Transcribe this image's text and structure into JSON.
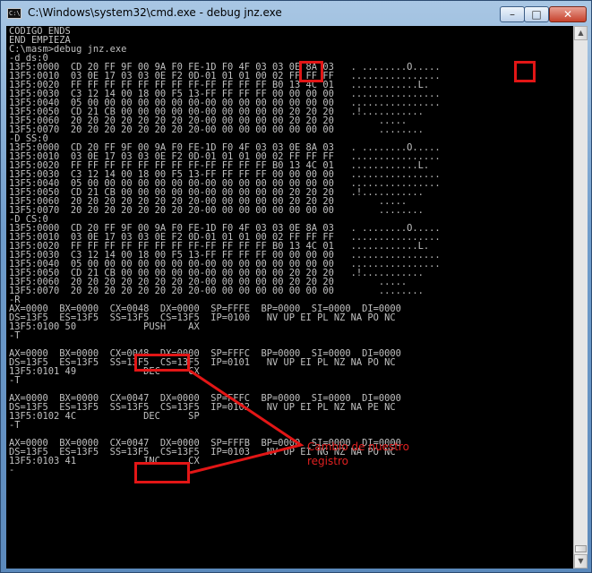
{
  "window": {
    "title": "C:\\Windows\\system32\\cmd.exe - debug  jnz.exe",
    "icon_text": "C:\\",
    "icon": "cmd-icon",
    "buttons": {
      "minimize": "–",
      "maximize": "□",
      "close": "✕"
    }
  },
  "console": {
    "lines": [
      "CODIGO ENDS",
      "END EMPIEZA",
      "C:\\masm>debug jnz.exe",
      "-d ds:0",
      "13F5:0000  CD 20 FF 9F 00 9A F0 FE-1D F0 4F 03 03 0E 8A 03   . ........O.....",
      "13F5:0010  03 0E 17 03 03 0E F2 0D-01 01 01 00 02 FF FF FF   ................",
      "13F5:0020  FF FF FF FF FF FF FF FF-FF FF FF FF B0 13 4C 01   ............L.",
      "13F5:0030  C3 12 14 00 18 00 F5 13-FF FF FF FF 00 00 00 00   ................",
      "13F5:0040  05 00 00 00 00 00 00 00-00 00 00 00 00 00 00 00   ................",
      "13F5:0050  CD 21 CB 00 00 00 00 00-00 00 00 00 00 20 20 20   .!...........",
      "13F5:0060  20 20 20 20 20 20 20 20-00 00 00 00 00 20 20 20        .....",
      "13F5:0070  20 20 20 20 20 20 20 20-00 00 00 00 00 00 00 00        ........",
      "-D SS:0",
      "13F5:0000  CD 20 FF 9F 00 9A F0 FE-1D F0 4F 03 03 0E 8A 03   . ........O.....",
      "13F5:0010  03 0E 17 03 03 0E F2 0D-01 01 01 00 02 FF FF FF   ................",
      "13F5:0020  FF FF FF FF FF FF FF FF-FF FF FF FF B0 13 4C 01   ............L.",
      "13F5:0030  C3 12 14 00 18 00 F5 13-FF FF FF FF 00 00 00 00   ................",
      "13F5:0040  05 00 00 00 00 00 00 00-00 00 00 00 00 00 00 00   ................",
      "13F5:0050  CD 21 CB 00 00 00 00 00-00 00 00 00 00 20 20 20   .!...........",
      "13F5:0060  20 20 20 20 20 20 20 20-00 00 00 00 00 20 20 20        .....",
      "13F5:0070  20 20 20 20 20 20 20 20-00 00 00 00 00 00 00 00        ........",
      "-D CS:0",
      "13F5:0000  CD 20 FF 9F 00 9A F0 FE-1D F0 4F 03 03 0E 8A 03   . ........O.....",
      "13F5:0010  03 0E 17 03 03 0E F2 0D-01 01 01 00 02 FF FF FF   ................",
      "13F5:0020  FF FF FF FF FF FF FF FF-FF FF FF FF B0 13 4C 01   ............L.",
      "13F5:0030  C3 12 14 00 18 00 F5 13-FF FF FF FF 00 00 00 00   ................",
      "13F5:0040  05 00 00 00 00 00 00 00-00 00 00 00 00 00 00 00   ................",
      "13F5:0050  CD 21 CB 00 00 00 00 00-00 00 00 00 00 20 20 20   .!...........",
      "13F5:0060  20 20 20 20 20 20 20 20-00 00 00 00 00 20 20 20        .....",
      "13F5:0070  20 20 20 20 20 20 20 20-00 00 00 00 00 00 00 00        ........",
      "-R",
      "AX=0000  BX=0000  CX=0048  DX=0000  SP=FFFE  BP=0000  SI=0000  DI=0000",
      "DS=13F5  ES=13F5  SS=13F5  CS=13F5  IP=0100   NV UP EI PL NZ NA PO NC",
      "13F5:0100 50            PUSH    AX",
      "-T",
      "",
      "AX=0000  BX=0000  CX=0048  DX=0000  SP=FFFC  BP=0000  SI=0000  DI=0000",
      "DS=13F5  ES=13F5  SS=13F5  CS=13F5  IP=0101   NV UP EI PL NZ NA PO NC",
      "13F5:0101 49            DEC     CX",
      "-T",
      "",
      "AX=0000  BX=0000  CX=0047  DX=0000  SP=FFFC  BP=0000  SI=0000  DI=0000",
      "DS=13F5  ES=13F5  SS=13F5  CS=13F5  IP=0102   NV UP EI PL NZ NA PE NC",
      "13F5:0102 4C            DEC     SP",
      "-T",
      "",
      "AX=0000  BX=0000  CX=0047  DX=0000  SP=FFFB  BP=0000  SI=0000  DI=0000",
      "DS=13F5  ES=13F5  SS=13F5  CS=13F5  IP=0103   NV UP EI NG NZ NA PO NC",
      "13F5:0103 41            INC     CX",
      "-"
    ]
  },
  "annotation": {
    "text_line1": "Cambio de nuestro",
    "text_line2": "registro",
    "color": "#e02020"
  },
  "colors": {
    "console_bg": "#000000",
    "console_fg": "#c0c0c0",
    "highlight": "#e21616"
  }
}
